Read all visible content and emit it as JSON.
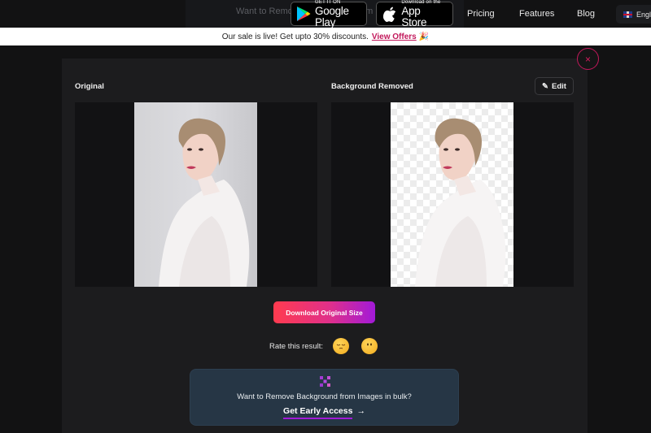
{
  "header": {
    "ghost_text": "Want to Remove Background from Images in bulk?",
    "google_play": {
      "small": "GET IT ON",
      "big": "Google Play"
    },
    "app_store": {
      "small": "Download on the",
      "big": "App Store"
    },
    "nav": [
      {
        "label": "Pricing"
      },
      {
        "label": "Features"
      },
      {
        "label": "Blog"
      }
    ],
    "language": {
      "label": "English",
      "flag": "uk-flag-icon"
    }
  },
  "sale_bar": {
    "text": "Our sale is live! Get upto 30% discounts.",
    "link": "View Offers",
    "emoji": "🎉"
  },
  "modal": {
    "close_icon": "×",
    "original_title": "Original",
    "removed_title": "Background Removed",
    "edit_label": "Edit",
    "edit_icon": "✎",
    "download_label": "Download Original Size",
    "rate_label": "Rate this result:",
    "ratings": [
      {
        "name": "pensive-face-emoji",
        "value": "bad"
      },
      {
        "name": "neutral-face-emoji",
        "value": "neutral"
      }
    ]
  },
  "bulk_banner": {
    "text": "Want to Remove Background from Images in bulk?",
    "cta": "Get Early Access",
    "arrow": "→"
  },
  "colors": {
    "accent_pink": "#c2185b",
    "gradient_start": "#ff3b4f",
    "gradient_end": "#a21ad8",
    "banner_bg": "#263645"
  }
}
